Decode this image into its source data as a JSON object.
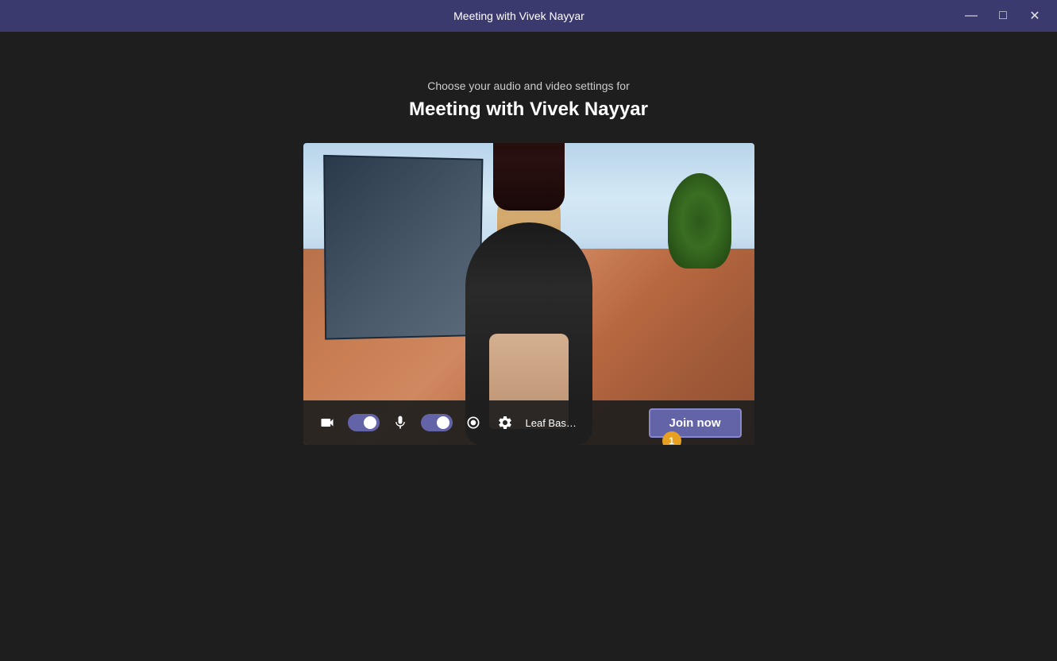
{
  "titleBar": {
    "title": "Meeting with Vivek Nayyar",
    "minimize": "—",
    "maximize": "□",
    "close": "✕"
  },
  "header": {
    "subtitle": "Choose your audio and video settings for",
    "meetingName": "Meeting with Vivek Nayyar"
  },
  "controls": {
    "deviceLabel": "Leaf Bass Hands-Free AG Au...",
    "joinButton": "Join now",
    "badge": "1"
  }
}
